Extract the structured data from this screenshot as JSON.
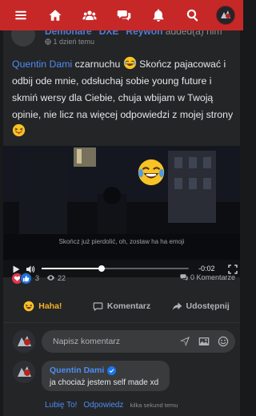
{
  "nav": {
    "items": [
      {
        "name": "menu-icon"
      },
      {
        "name": "home-icon"
      },
      {
        "name": "groups-icon"
      },
      {
        "name": "messages-icon"
      },
      {
        "name": "notifications-icon"
      },
      {
        "name": "search-icon"
      }
    ],
    "accent": "#c62828"
  },
  "post": {
    "author": "Demonare \"DXE\" Reywon",
    "author_tail": "added(a) him",
    "time": "1 dzień temu",
    "time_icon": "globe-icon",
    "text": {
      "mention": "Quentin Dami",
      "part1": " czarnuchu ",
      "part2": " Skończ pajacować i odbij ode mnie, odsłuchaj sobie young future i skmiń wersy dla Ciebie, chuja wbijam w Twoją opinie, nie licz na więcej odpowiedzi z mojej strony "
    }
  },
  "video": {
    "subtitle": "Skończ już pierdolić, oh, zostaw ha ha emoji",
    "progress_fraction": 0.41,
    "time_remaining": "-0:02"
  },
  "stats": {
    "reaction_count": "3",
    "views": "22",
    "comments": "0 Komentarze"
  },
  "actions": {
    "react_label": "Haha!",
    "comment_label": "Komentarz",
    "share_label": "Udostępnij"
  },
  "comment_box": {
    "placeholder": "Napisz komentarz"
  },
  "reply": {
    "author": "Quentin Dami",
    "text": "ja chociaż jestem self made xd",
    "like_label": "Lubię To!",
    "reply_label": "Odpowiedz",
    "time": "kilka sekund temu"
  }
}
